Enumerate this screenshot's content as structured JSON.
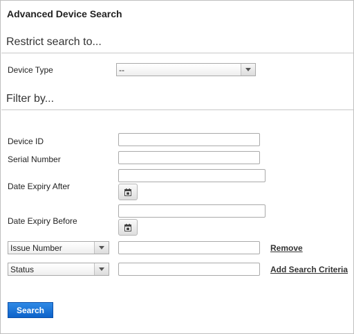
{
  "page": {
    "title": "Advanced Device Search"
  },
  "restrict": {
    "heading": "Restrict search to...",
    "device_type_label": "Device Type",
    "device_type_value": "--"
  },
  "filter": {
    "heading": "Filter by...",
    "device_id_label": "Device ID",
    "device_id_value": "",
    "serial_number_label": "Serial Number",
    "serial_number_value": "",
    "date_expiry_after_label": "Date Expiry After",
    "date_expiry_after_value": "",
    "date_expiry_before_label": "Date Expiry Before",
    "date_expiry_before_value": "",
    "criteria": [
      {
        "field": "Issue Number",
        "value": "",
        "action": "Remove"
      },
      {
        "field": "Status",
        "value": "",
        "action": "Add Search Criteria"
      }
    ]
  },
  "actions": {
    "search_label": "Search"
  },
  "icons": {
    "calendar": "calendar-icon",
    "dropdown": "chevron-down-icon"
  },
  "colors": {
    "search_button": "#1a6fd6",
    "border": "#bfbfbf"
  }
}
